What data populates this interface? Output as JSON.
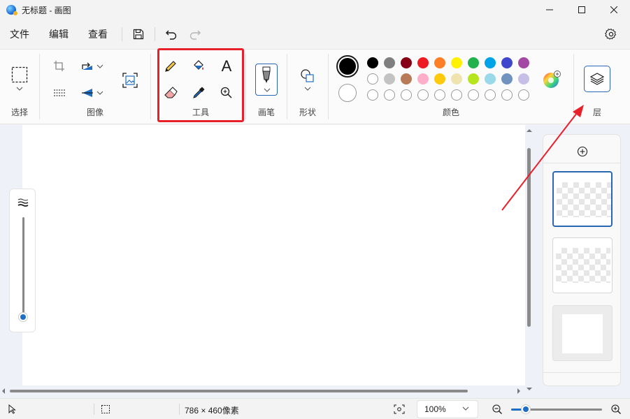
{
  "window": {
    "title": "无标题 - 画图"
  },
  "menu": {
    "file": "文件",
    "edit": "编辑",
    "view": "查看"
  },
  "ribbon": {
    "groups": {
      "select": "选择",
      "image": "图像",
      "tools": "工具",
      "brushes": "画笔",
      "shapes": "形状",
      "colors": "颜色",
      "layers": "层"
    },
    "text_tool_glyph": "A"
  },
  "colors": {
    "primary": "#000000",
    "secondary": "#ffffff",
    "palette_row1": [
      "#000000",
      "#7f7f7f",
      "#880015",
      "#ed1c24",
      "#ff7f27",
      "#fff200",
      "#22b14c",
      "#00a2e8",
      "#3f48cc",
      "#a349a4"
    ],
    "palette_row2": [
      "#ffffff",
      "#c3c3c3",
      "#b97a57",
      "#ffaec9",
      "#ffc90e",
      "#efe4b0",
      "#b5e61d",
      "#99d9ea",
      "#7092be",
      "#c8bfe7"
    ],
    "palette_row3_empty_count": 10,
    "highlight_border": "#e8202a",
    "accent": "#1f6fc5"
  },
  "status": {
    "canvas_size": "786 × 460像素",
    "zoom": "100%"
  },
  "icons": {
    "select": "dashed-rect-select-icon",
    "crop": "crop-icon",
    "rotate": "rotate-icon",
    "resize": "resize-icon",
    "flip": "flip-icon",
    "image_search": "image-search-icon",
    "pencil": "pencil-icon",
    "fill": "fill-bucket-icon",
    "text": "text-icon",
    "eraser": "eraser-icon",
    "picker": "color-picker-icon",
    "magnifier": "magnifier-icon",
    "brush": "brush-icon",
    "shapes": "shapes-icon",
    "edit_colors": "color-wheel-icon",
    "layers": "layers-icon"
  }
}
